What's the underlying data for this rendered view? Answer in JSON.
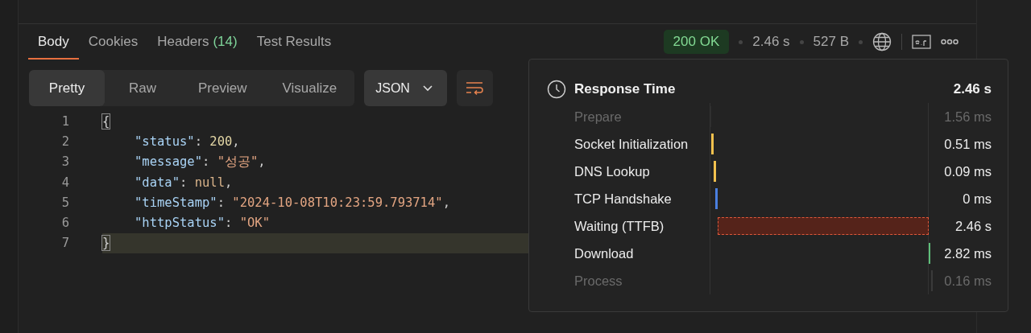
{
  "tabs": [
    {
      "label": "Body",
      "selected": true
    },
    {
      "label": "Cookies",
      "selected": false
    },
    {
      "label": "Headers",
      "count": "(14)",
      "selected": false
    },
    {
      "label": "Test Results",
      "selected": false
    }
  ],
  "status": {
    "code": "200 OK",
    "time": "2.46 s",
    "size": "527 B"
  },
  "view_modes": [
    {
      "label": "Pretty",
      "selected": true
    },
    {
      "label": "Raw",
      "selected": false
    },
    {
      "label": "Preview",
      "selected": false
    },
    {
      "label": "Visualize",
      "selected": false
    }
  ],
  "format": {
    "value": "JSON"
  },
  "code_lines": [
    {
      "number": "1",
      "current": false,
      "tokens": [
        {
          "kind": "bracket",
          "text": "{"
        }
      ]
    },
    {
      "number": "2",
      "current": false,
      "tokens": [
        {
          "kind": "key",
          "text": "\"status\""
        },
        {
          "kind": "punct",
          "text": ": "
        },
        {
          "kind": "number",
          "text": "200"
        },
        {
          "kind": "punct",
          "text": ","
        }
      ]
    },
    {
      "number": "3",
      "current": false,
      "tokens": [
        {
          "kind": "key",
          "text": "\"message\""
        },
        {
          "kind": "punct",
          "text": ": "
        },
        {
          "kind": "string",
          "text": "\"성공\""
        },
        {
          "kind": "punct",
          "text": ","
        }
      ]
    },
    {
      "number": "4",
      "current": false,
      "tokens": [
        {
          "kind": "key",
          "text": "\"data\""
        },
        {
          "kind": "punct",
          "text": ": "
        },
        {
          "kind": "null",
          "text": "null"
        },
        {
          "kind": "punct",
          "text": ","
        }
      ]
    },
    {
      "number": "5",
      "current": false,
      "tokens": [
        {
          "kind": "key",
          "text": "\"timeStamp\""
        },
        {
          "kind": "punct",
          "text": ": "
        },
        {
          "kind": "string",
          "text": "\"2024-10-08T10:23:59.793714\""
        },
        {
          "kind": "punct",
          "text": ","
        }
      ]
    },
    {
      "number": "6",
      "current": false,
      "tokens": [
        {
          "kind": "key",
          "text": "\"httpStatus\""
        },
        {
          "kind": "punct",
          "text": ": "
        },
        {
          "kind": "string",
          "text": "\"OK\""
        }
      ]
    },
    {
      "number": "7",
      "current": true,
      "tokens": [
        {
          "kind": "bracket",
          "text": "}"
        }
      ]
    }
  ],
  "response_time": {
    "title": "Response Time",
    "total": "2.46 s",
    "phases": [
      {
        "label": "Prepare",
        "value": "1.56 ms",
        "dimmed": true,
        "color": "#2e2e2e"
      },
      {
        "label": "Socket Initialization",
        "value": "0.51 ms",
        "dimmed": false,
        "color": "#f2c14e"
      },
      {
        "label": "DNS Lookup",
        "value": "0.09 ms",
        "dimmed": false,
        "color": "#f2c14e"
      },
      {
        "label": "TCP Handshake",
        "value": "0 ms",
        "dimmed": false,
        "color": "#4a7fe0"
      },
      {
        "label": "Waiting (TTFB)",
        "value": "2.46 s",
        "dimmed": false,
        "color": "#e0583a"
      },
      {
        "label": "Download",
        "value": "2.82 ms",
        "dimmed": false,
        "color": "#5fbf7a"
      },
      {
        "label": "Process",
        "value": "0.16 ms",
        "dimmed": true,
        "color": "#3a3a3a"
      }
    ]
  }
}
